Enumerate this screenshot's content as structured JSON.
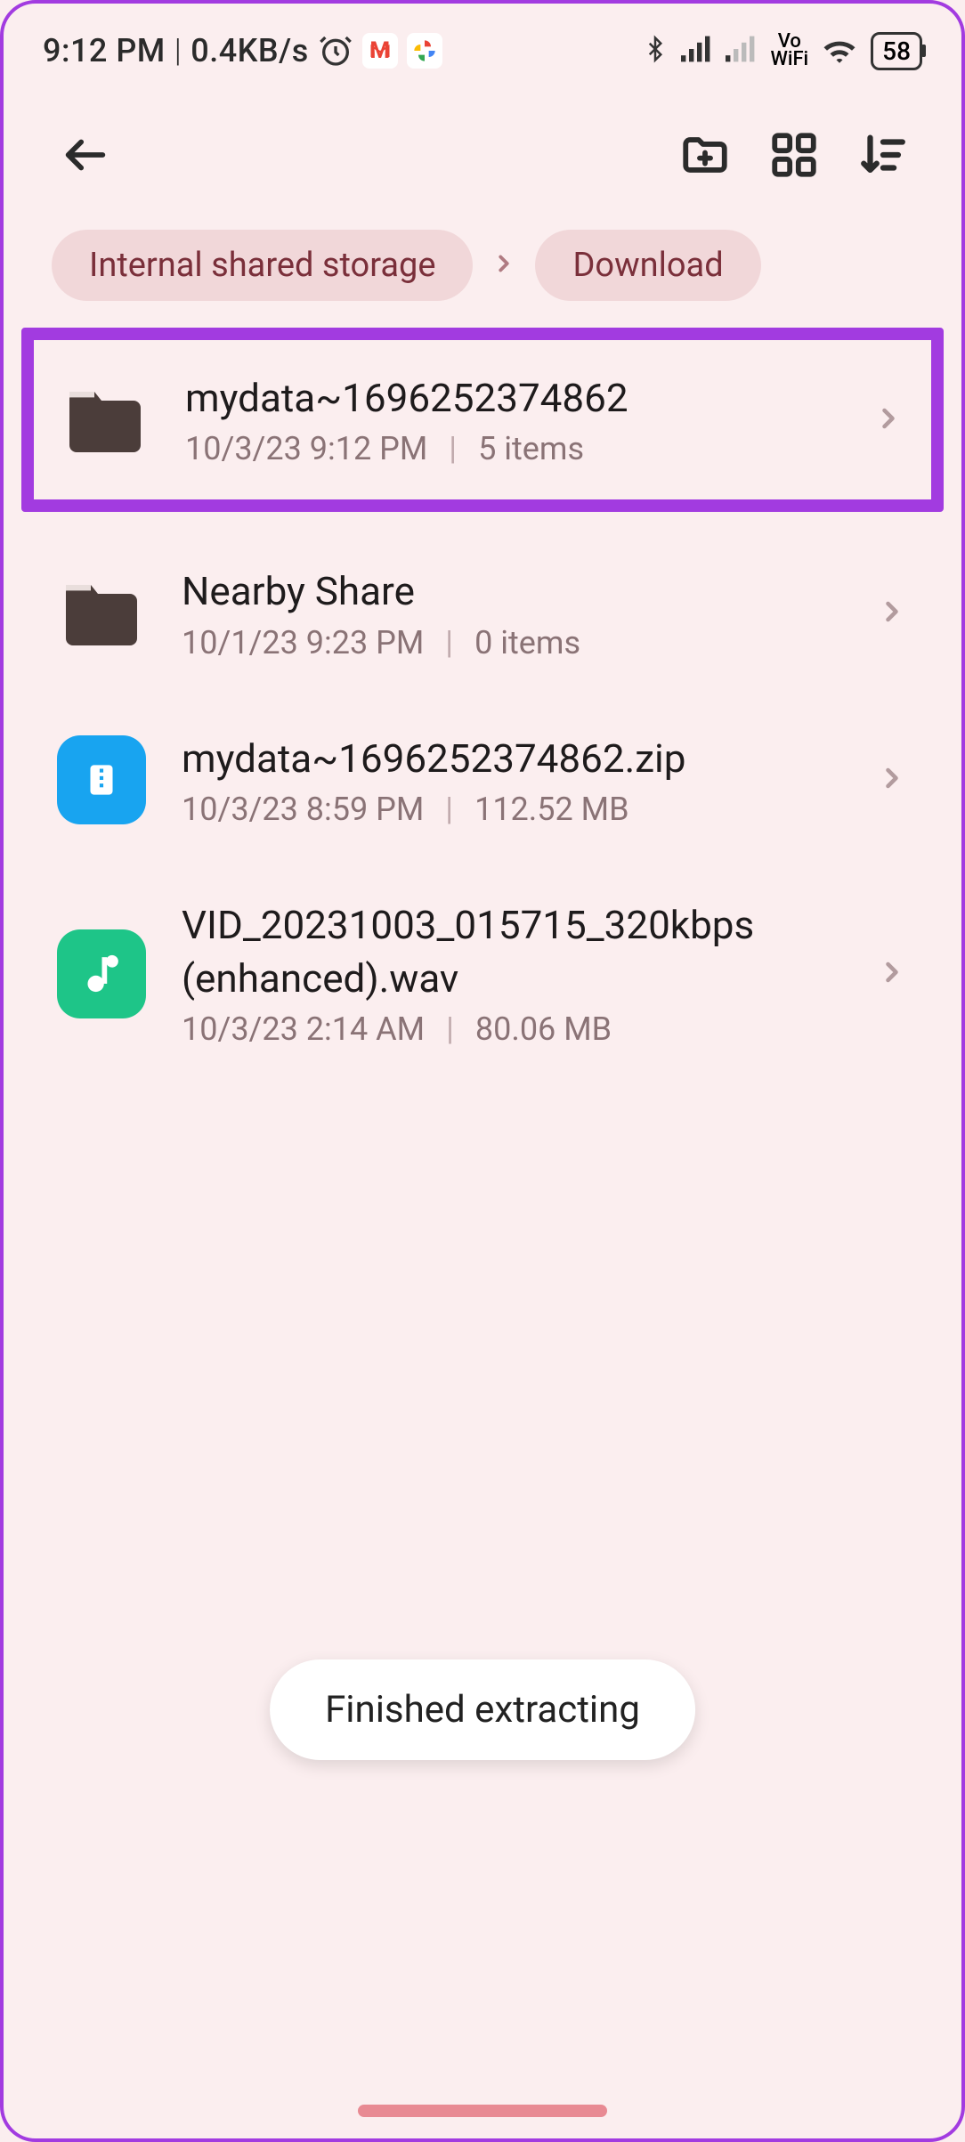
{
  "status_bar": {
    "time": "9:12 PM",
    "speed": "0.4KB/s",
    "battery": "58",
    "icons": {
      "alarm": "alarm",
      "gmail": "M",
      "photos": "✦",
      "bluetooth": "bluetooth",
      "signal1": "signal-full",
      "signal2": "signal-weak",
      "vowifi_top": "Vo",
      "vowifi_bottom": "WiFi",
      "wifi": "wifi"
    }
  },
  "appbar": {
    "back": "back",
    "new_folder": "new-folder",
    "view_grid": "grid-view",
    "sort": "sort-desc"
  },
  "breadcrumb": {
    "items": [
      "Internal shared storage",
      "Download"
    ]
  },
  "files": [
    {
      "type": "folder",
      "highlighted": true,
      "name": "mydata~1696252374862",
      "date": "10/3/23 9:12 PM",
      "meta": "5 items"
    },
    {
      "type": "folder",
      "highlighted": false,
      "name": "Nearby Share",
      "date": "10/1/23 9:23 PM",
      "meta": "0 items"
    },
    {
      "type": "zip",
      "highlighted": false,
      "name": "mydata~1696252374862.zip",
      "date": "10/3/23 8:59 PM",
      "meta": "112.52 MB"
    },
    {
      "type": "audio",
      "highlighted": false,
      "name": "VID_20231003_015715_320kbps (enhanced).wav",
      "date": "10/3/23 2:14 AM",
      "meta": "80.06 MB"
    }
  ],
  "toast": {
    "message": "Finished extracting"
  }
}
